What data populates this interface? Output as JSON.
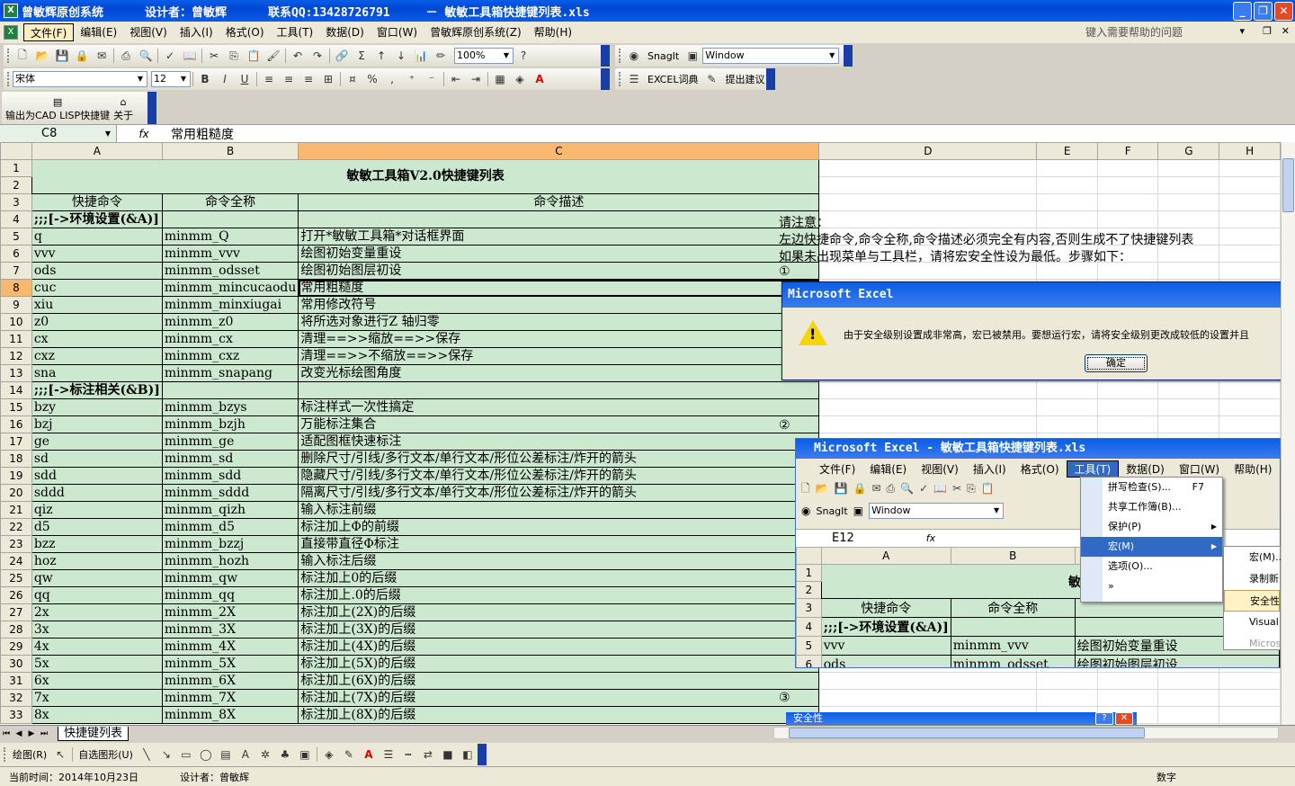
{
  "window": {
    "title_app": "曾敏辉原创系统",
    "title_designer": "设计者：曾敏辉",
    "title_contact": "联系QQ:13428726791",
    "title_file": "－ 敏敏工具箱快捷键列表.xls",
    "min": "_",
    "max": "❐",
    "close": "✕"
  },
  "menubar": {
    "items": [
      "文件(F)",
      "编辑(E)",
      "视图(V)",
      "插入(I)",
      "格式(O)",
      "工具(T)",
      "数据(D)",
      "窗口(W)",
      "曾敏辉原创系统(Z)",
      "帮助(H)"
    ],
    "help_placeholder": "键入需要帮助的问题"
  },
  "toolbar": {
    "zoom": "100%",
    "snagit": "SnagIt",
    "window_combo": "Window",
    "font_name": "宋体",
    "font_size": "12",
    "excel_dict": "EXCEL词典",
    "suggest": "提出建议",
    "export_cad": "输出为CAD LISP快捷键",
    "about": "关于"
  },
  "formula": {
    "cell_ref": "C8",
    "fx": "fx",
    "value": "常用粗糙度"
  },
  "grid": {
    "columns": [
      "A",
      "B",
      "C",
      "D",
      "E",
      "F",
      "G",
      "H"
    ],
    "selected_row": "8",
    "selected_col": "C",
    "title": "敏敏工具箱V2.0快捷键列表",
    "header": [
      "快捷命令",
      "命令全称",
      "命令描述"
    ],
    "rows": [
      {
        "n": "4",
        "a": ";;;[->环境设置(&A)]",
        "b": "",
        "c": "",
        "section": true
      },
      {
        "n": "5",
        "a": "q",
        "b": "minmm_Q",
        "c": "打开*敏敏工具箱*对话框界面"
      },
      {
        "n": "6",
        "a": "vvv",
        "b": "minmm_vvv",
        "c": "绘图初始变量重设"
      },
      {
        "n": "7",
        "a": "ods",
        "b": "minmm_odsset",
        "c": "绘图初始图层初设"
      },
      {
        "n": "8",
        "a": "cuc",
        "b": "minmm_mincucaodu",
        "c": "常用粗糙度"
      },
      {
        "n": "9",
        "a": "xiu",
        "b": "minmm_minxiugai",
        "c": "常用修改符号"
      },
      {
        "n": "10",
        "a": "z0",
        "b": "minmm_z0",
        "c": "将所选对象进行Z 轴归零"
      },
      {
        "n": "11",
        "a": "cx",
        "b": "minmm_cx",
        "c": "清理==>>缩放==>>保存"
      },
      {
        "n": "12",
        "a": "cxz",
        "b": "minmm_cxz",
        "c": "清理==>>不缩放==>>保存"
      },
      {
        "n": "13",
        "a": "sna",
        "b": "minmm_snapang",
        "c": "改变光标绘图角度"
      },
      {
        "n": "14",
        "a": ";;;[->标注相关(&B)]",
        "b": "",
        "c": "",
        "section": true
      },
      {
        "n": "15",
        "a": "bzy",
        "b": "minmm_bzys",
        "c": "标注样式一次性搞定"
      },
      {
        "n": "16",
        "a": "bzj",
        "b": "minmm_bzjh",
        "c": "万能标注集合"
      },
      {
        "n": "17",
        "a": "ge",
        "b": "minmm_ge",
        "c": "适配图框快速标注"
      },
      {
        "n": "18",
        "a": "sd",
        "b": "minmm_sd",
        "c": "删除尺寸/引线/多行文本/单行文本/形位公差标注/炸开的箭头"
      },
      {
        "n": "19",
        "a": "sdd",
        "b": "minmm_sdd",
        "c": "隐藏尺寸/引线/多行文本/单行文本/形位公差标注/炸开的箭头"
      },
      {
        "n": "20",
        "a": "sddd",
        "b": "minmm_sddd",
        "c": "隔离尺寸/引线/多行文本/单行文本/形位公差标注/炸开的箭头"
      },
      {
        "n": "21",
        "a": "qiz",
        "b": "minmm_qizh",
        "c": "输入标注前缀"
      },
      {
        "n": "22",
        "a": "d5",
        "b": "minmm_d5",
        "c": "标注加上Φ的前缀"
      },
      {
        "n": "23",
        "a": "bzz",
        "b": "minmm_bzzj",
        "c": "直接带直径Φ标注"
      },
      {
        "n": "24",
        "a": "hoz",
        "b": "minmm_hozh",
        "c": "输入标注后缀"
      },
      {
        "n": "25",
        "a": "qw",
        "b": "minmm_qw",
        "c": "标注加上0的后缀"
      },
      {
        "n": "26",
        "a": "qq",
        "b": "minmm_qq",
        "c": "标注加上.0的后缀"
      },
      {
        "n": "27",
        "a": "2x",
        "b": "minmm_2X",
        "c": "标注加上(2X)的后缀"
      },
      {
        "n": "28",
        "a": "3x",
        "b": "minmm_3X",
        "c": "标注加上(3X)的后缀"
      },
      {
        "n": "29",
        "a": "4x",
        "b": "minmm_4X",
        "c": "标注加上(4X)的后缀"
      },
      {
        "n": "30",
        "a": "5x",
        "b": "minmm_5X",
        "c": "标注加上(5X)的后缀"
      },
      {
        "n": "31",
        "a": "6x",
        "b": "minmm_6X",
        "c": "标注加上(6X)的后缀"
      },
      {
        "n": "32",
        "a": "7x",
        "b": "minmm_7X",
        "c": "标注加上(7X)的后缀"
      },
      {
        "n": "33",
        "a": "8x",
        "b": "minmm_8X",
        "c": "标注加上(8X)的后缀"
      }
    ]
  },
  "notes": {
    "line1": "请注意：",
    "line2": "左边快捷命令,命令全称,命令描述必须完全有内容,否则生成不了快捷键列表",
    "line3": "如果未出现菜单与工具栏，请将宏安全性设为最低。步骤如下：",
    "step1": "①",
    "step2": "②",
    "step3": "③"
  },
  "dialog": {
    "title": "Microsoft Excel",
    "message": "由于安全级别设置成非常高，宏已被禁用。要想运行宏，请将安全级别更改成较低的设置并且",
    "ok": "确定"
  },
  "shot2": {
    "title": "Microsoft Excel - 敏敏工具箱快捷键列表.xls",
    "menus": [
      "文件(F)",
      "编辑(E)",
      "视图(V)",
      "插入(I)",
      "格式(O)",
      "工具(T)",
      "数据(D)",
      "窗口(W)",
      "帮助(H)"
    ],
    "snagit": "SnagIt",
    "window_combo": "Window",
    "cell_ref": "E12",
    "fx": "fx",
    "columns": [
      "A",
      "B"
    ],
    "title_partial": "敏敏",
    "header": [
      "快捷命令",
      "命令全称"
    ],
    "rows": [
      {
        "n": "4",
        "a": ";;;[->环境设置(&A)]",
        "b": "",
        "c": ""
      },
      {
        "n": "5",
        "a": "vvv",
        "b": "minmm_vvv",
        "c": "绘图初始变量重设"
      },
      {
        "n": "6",
        "a": "ods",
        "b": "minmm_odsset",
        "c": "绘图初始图层初设"
      }
    ],
    "tools_menu": [
      {
        "label": "拼写检查(S)...",
        "shortcut": "F7"
      },
      {
        "label": "共享工作簿(B)..."
      },
      {
        "label": "保护(P)",
        "arrow": true
      },
      {
        "label": "宏(M)",
        "arrow": true,
        "active": true
      },
      {
        "label": "选项(O)..."
      },
      {
        "label": "»"
      }
    ],
    "submenu": [
      "宏(M)...",
      "录制新",
      "安全性",
      "Visual",
      "Micros"
    ]
  },
  "dialog3": {
    "title": "安全性",
    "help": "?",
    "close": "✕"
  },
  "tabs": {
    "nav": [
      "⏮",
      "◀",
      "▶",
      "⏭"
    ],
    "active": "快捷键列表"
  },
  "drawbar": {
    "draw": "绘图(R)",
    "autoshape": "自选图形(U)"
  },
  "status": {
    "time": "当前时间：2014年10月23日",
    "designer": "设计者：曾敏辉",
    "mode": "数字"
  },
  "colors": {
    "title_bar": "#0a5ee6",
    "cell_green": "#cce8cf",
    "selected_header": "#f8b870"
  }
}
